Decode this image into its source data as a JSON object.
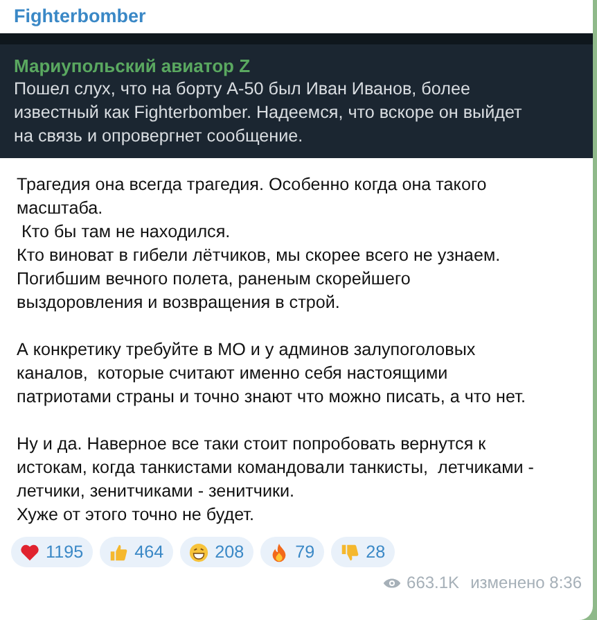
{
  "channel": {
    "name": "Fighterbomber"
  },
  "embedded_screenshot": {
    "author": "Мариупольский авиатор Z",
    "lines": [
      "Пошел слух, что на борту А-50 был Иван Иванов, более",
      "известный как Fighterbomber. Надеемся, что вскоре он выйдет",
      "на связь и опровергнет сообщение."
    ]
  },
  "message": {
    "paragraphs": [
      [
        "Трагедия она всегда трагедия. Особенно когда она такого",
        "масштаба.",
        " Кто бы там не находился.",
        "Кто виноват в гибели лётчиков, мы скорее всего не узнаем.",
        "Погибшим вечного полета, раненым скорейшего",
        "выздоровления и возвращения в строй."
      ],
      [
        "А конкретику требуйте в МО и у админов залупоголовых",
        "каналов,  которые считают именно себя настоящими",
        "патриотами страны и точно знают что можно писать, а что нет."
      ],
      [
        "Ну и да. Наверное все таки стоит попробовать вернутся к",
        "истокам, когда танкистами командовали танкисты,  летчиками -",
        "летчики, зенитчиками - зенитчики.",
        "Хуже от этого точно не будет."
      ]
    ]
  },
  "reactions": [
    {
      "kind": "heart",
      "count": "1195"
    },
    {
      "kind": "thumbs-up",
      "count": "464"
    },
    {
      "kind": "grin",
      "count": "208"
    },
    {
      "kind": "fire",
      "count": "79"
    },
    {
      "kind": "thumbs-down",
      "count": "28"
    }
  ],
  "footer": {
    "views": "663.1K",
    "edited": "изменено 8:36"
  }
}
